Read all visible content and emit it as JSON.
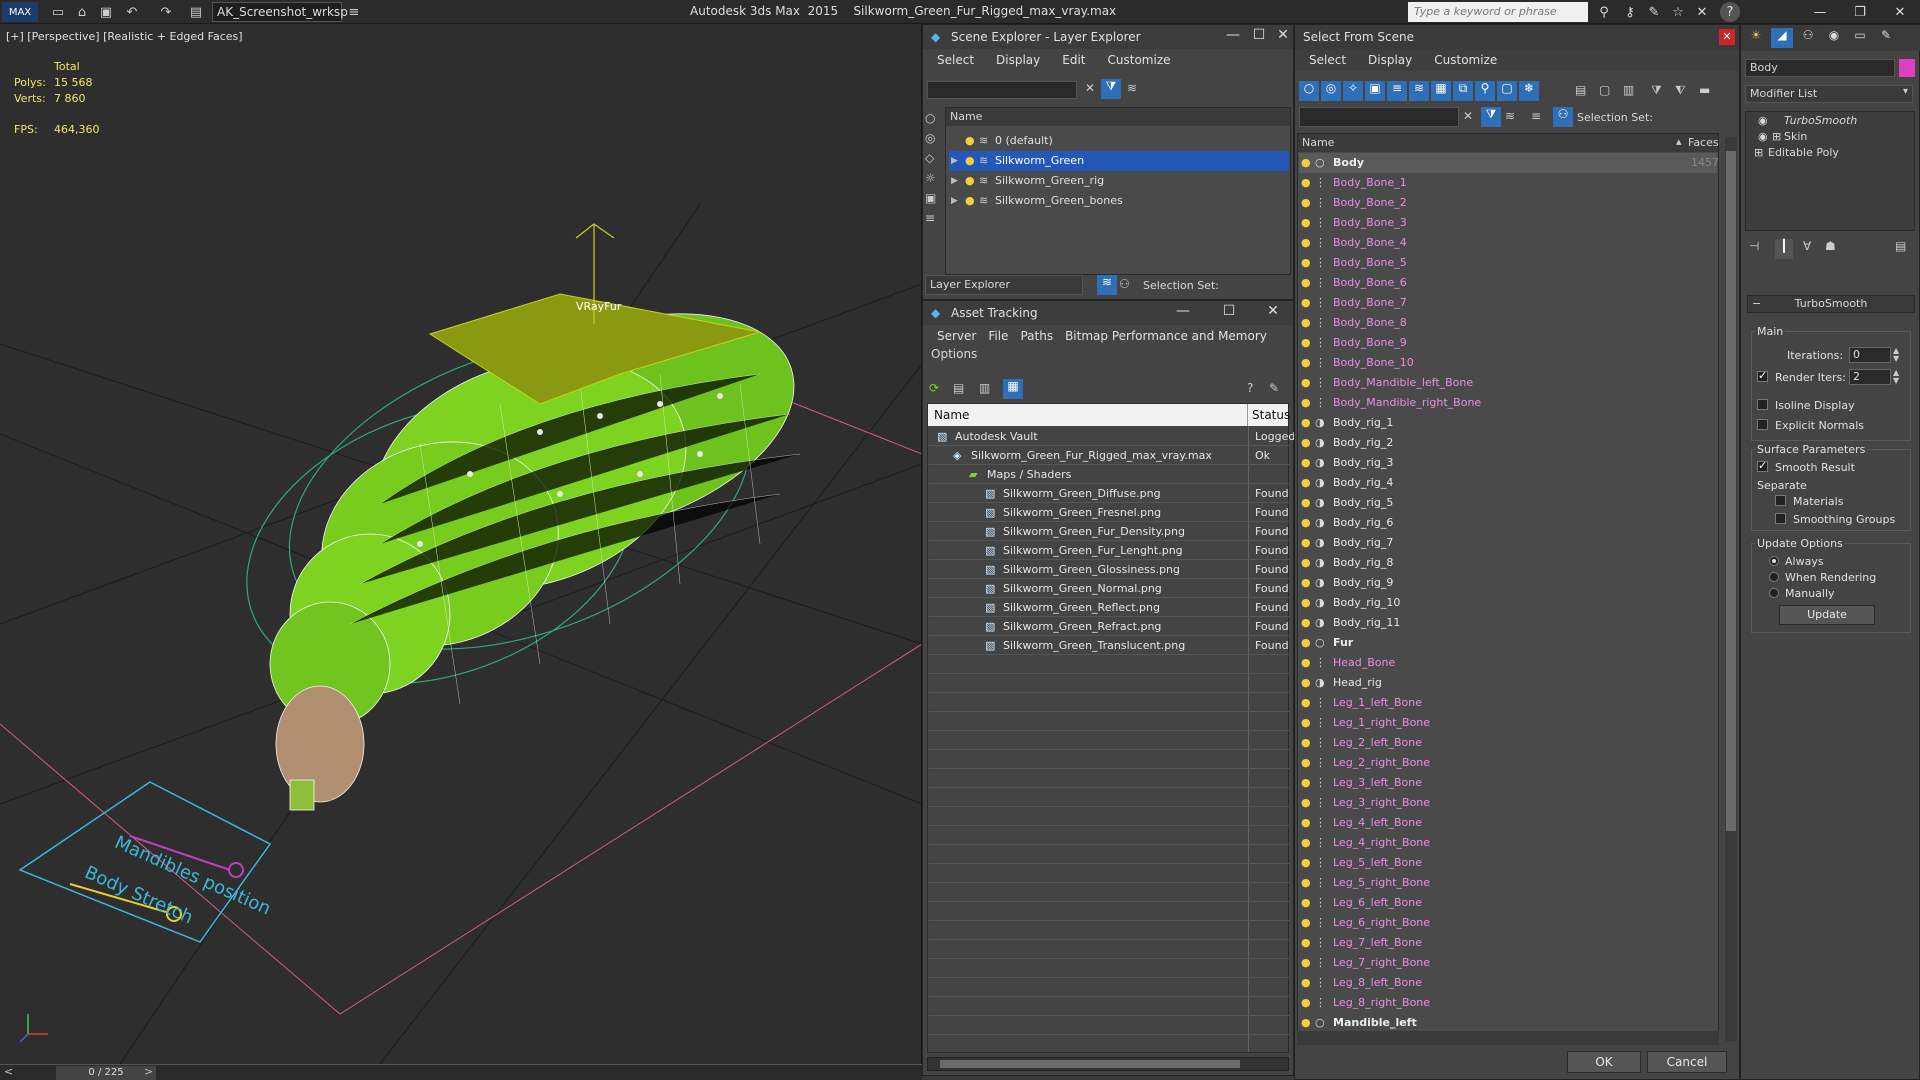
{
  "titlebar": {
    "workspace": "AK_Screenshot_wrksp",
    "app_name": "Autodesk 3ds Max  2015",
    "file_name": "Silkworm_Green_Fur_Rigged_max_vray.max",
    "search_placeholder": "Type a keyword or phrase"
  },
  "viewport": {
    "label": "[+] [Perspective] [Realistic + Edged Faces]",
    "stats": {
      "total_label": "Total",
      "polys_label": "Polys:",
      "polys_value": "15 568",
      "verts_label": "Verts:",
      "verts_value": "7 860",
      "fps_label": "FPS:",
      "fps_value": "464,360"
    },
    "gizmo_label": "VRayFur",
    "ctrl_text_1": "Mandibles position",
    "ctrl_text_2": "Body Stretch",
    "timeline": "0 / 225"
  },
  "scene_explorer": {
    "title": "Scene Explorer - Layer Explorer",
    "menu": [
      "Select",
      "Display",
      "Edit",
      "Customize"
    ],
    "column_name": "Name",
    "layers": [
      {
        "name": "0 (default)",
        "selected": false,
        "expandable": false
      },
      {
        "name": "Silkworm_Green",
        "selected": true,
        "expandable": true
      },
      {
        "name": "Silkworm_Green_rig",
        "selected": false,
        "expandable": true
      },
      {
        "name": "Silkworm_Green_bones",
        "selected": false,
        "expandable": true
      }
    ],
    "explorer_dropdown": "Layer Explorer",
    "selection_set_label": "Selection Set:"
  },
  "asset_tracking": {
    "title": "Asset Tracking",
    "menu": [
      "Server",
      "File",
      "Paths",
      "Bitmap Performance and Memory"
    ],
    "menu2": "Options",
    "col_name": "Name",
    "col_status": "Status",
    "rows": [
      {
        "name": "Autodesk Vault",
        "status": "Logged",
        "indent": 1
      },
      {
        "name": "Silkworm_Green_Fur_Rigged_max_vray.max",
        "status": "Ok",
        "indent": 2
      },
      {
        "name": "Maps / Shaders",
        "status": "",
        "indent": 3
      },
      {
        "name": "Silkworm_Green_Diffuse.png",
        "status": "Found",
        "indent": 4
      },
      {
        "name": "Silkworm_Green_Fresnel.png",
        "status": "Found",
        "indent": 4
      },
      {
        "name": "Silkworm_Green_Fur_Density.png",
        "status": "Found",
        "indent": 4
      },
      {
        "name": "Silkworm_Green_Fur_Lenght.png",
        "status": "Found",
        "indent": 4
      },
      {
        "name": "Silkworm_Green_Glossiness.png",
        "status": "Found",
        "indent": 4
      },
      {
        "name": "Silkworm_Green_Normal.png",
        "status": "Found",
        "indent": 4
      },
      {
        "name": "Silkworm_Green_Reflect.png",
        "status": "Found",
        "indent": 4
      },
      {
        "name": "Silkworm_Green_Refract.png",
        "status": "Found",
        "indent": 4
      },
      {
        "name": "Silkworm_Green_Translucent.png",
        "status": "Found",
        "indent": 4
      }
    ]
  },
  "select_from_scene": {
    "title": "Select From Scene",
    "menu": [
      "Select",
      "Display",
      "Customize"
    ],
    "selection_set_label": "Selection Set:",
    "col_name": "Name",
    "col_faces": "Faces",
    "first_faces": "1457",
    "objects": [
      {
        "name": "Body",
        "kind": "bold"
      },
      {
        "name": "Body_Bone_1",
        "kind": "bone"
      },
      {
        "name": "Body_Bone_2",
        "kind": "bone"
      },
      {
        "name": "Body_Bone_3",
        "kind": "bone"
      },
      {
        "name": "Body_Bone_4",
        "kind": "bone"
      },
      {
        "name": "Body_Bone_5",
        "kind": "bone"
      },
      {
        "name": "Body_Bone_6",
        "kind": "bone"
      },
      {
        "name": "Body_Bone_7",
        "kind": "bone"
      },
      {
        "name": "Body_Bone_8",
        "kind": "bone"
      },
      {
        "name": "Body_Bone_9",
        "kind": "bone"
      },
      {
        "name": "Body_Bone_10",
        "kind": "bone"
      },
      {
        "name": "Body_Mandible_left_Bone",
        "kind": "bone"
      },
      {
        "name": "Body_Mandible_right_Bone",
        "kind": "bone"
      },
      {
        "name": "Body_rig_1",
        "kind": "rig"
      },
      {
        "name": "Body_rig_2",
        "kind": "rig"
      },
      {
        "name": "Body_rig_3",
        "kind": "rig"
      },
      {
        "name": "Body_rig_4",
        "kind": "rig"
      },
      {
        "name": "Body_rig_5",
        "kind": "rig"
      },
      {
        "name": "Body_rig_6",
        "kind": "rig"
      },
      {
        "name": "Body_rig_7",
        "kind": "rig"
      },
      {
        "name": "Body_rig_8",
        "kind": "rig"
      },
      {
        "name": "Body_rig_9",
        "kind": "rig"
      },
      {
        "name": "Body_rig_10",
        "kind": "rig"
      },
      {
        "name": "Body_rig_11",
        "kind": "rig"
      },
      {
        "name": "Fur",
        "kind": "bold"
      },
      {
        "name": "Head_Bone",
        "kind": "bone"
      },
      {
        "name": "Head_rig",
        "kind": "rig"
      },
      {
        "name": "Leg_1_left_Bone",
        "kind": "bone"
      },
      {
        "name": "Leg_1_right_Bone",
        "kind": "bone"
      },
      {
        "name": "Leg_2_left_Bone",
        "kind": "bone"
      },
      {
        "name": "Leg_2_right_Bone",
        "kind": "bone"
      },
      {
        "name": "Leg_3_left_Bone",
        "kind": "bone"
      },
      {
        "name": "Leg_3_right_Bone",
        "kind": "bone"
      },
      {
        "name": "Leg_4_left_Bone",
        "kind": "bone"
      },
      {
        "name": "Leg_4_right_Bone",
        "kind": "bone"
      },
      {
        "name": "Leg_5_left_Bone",
        "kind": "bone"
      },
      {
        "name": "Leg_5_right_Bone",
        "kind": "bone"
      },
      {
        "name": "Leg_6_left_Bone",
        "kind": "bone"
      },
      {
        "name": "Leg_6_right_Bone",
        "kind": "bone"
      },
      {
        "name": "Leg_7_left_Bone",
        "kind": "bone"
      },
      {
        "name": "Leg_7_right_Bone",
        "kind": "bone"
      },
      {
        "name": "Leg_8_left_Bone",
        "kind": "bone"
      },
      {
        "name": "Leg_8_right_Bone",
        "kind": "bone"
      },
      {
        "name": "Mandible_left",
        "kind": "bold"
      }
    ],
    "ok_label": "OK",
    "cancel_label": "Cancel"
  },
  "command_panel": {
    "object_name": "Body",
    "modifier_list": "Modifier List",
    "stack": [
      "TurboSmooth",
      "Skin",
      "Editable Poly"
    ],
    "rollout_title": "TurboSmooth",
    "main_label": "Main",
    "iterations_label": "Iterations:",
    "iterations_value": "0",
    "render_iters_label": "Render Iters:",
    "render_iters_value": "2",
    "render_iters_checked": true,
    "isoline_label": "Isoline Display",
    "explicit_normals_label": "Explicit Normals",
    "surface_params_label": "Surface Parameters",
    "smooth_result_label": "Smooth Result",
    "smooth_result_checked": true,
    "separate_label": "Separate",
    "materials_label": "Materials",
    "smoothing_groups_label": "Smoothing Groups",
    "update_options_label": "Update Options",
    "always_label": "Always",
    "when_rendering_label": "When Rendering",
    "manually_label": "Manually",
    "update_button": "Update",
    "color_swatch": "#e040c0"
  },
  "colors": {
    "selection_blue": "#2458b8",
    "bone_pink": "#e88fe0",
    "stats_yellow": "#f0e66a",
    "worm_green": "#7ed321"
  }
}
